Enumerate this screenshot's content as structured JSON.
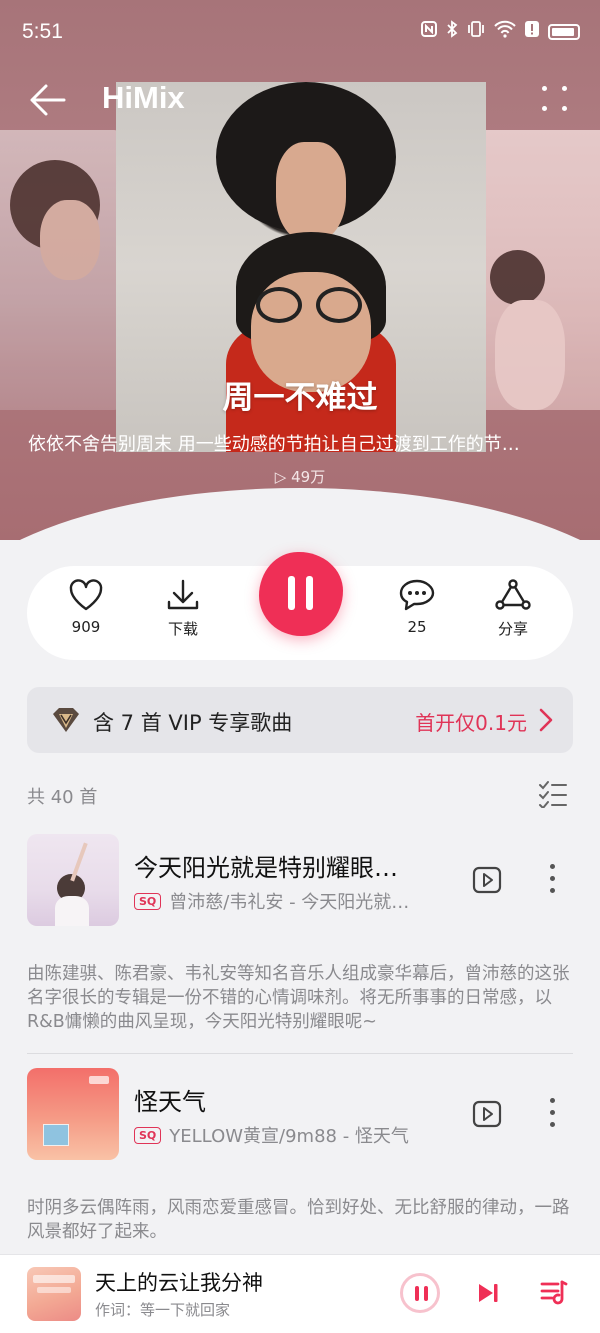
{
  "status_bar": {
    "time": "5:51",
    "icons": [
      "nfc-icon",
      "bluetooth-icon",
      "vibrate-icon",
      "wifi-icon",
      "alert-icon",
      "battery-icon"
    ]
  },
  "header": {
    "app_title": "HiMix",
    "back_icon": "back-arrow-icon",
    "more_icon": "more-dots-icon"
  },
  "playlist": {
    "title": "周一不难过",
    "description": "依依不舍告别周末 用一些动感的节拍让自己过渡到工作的节…",
    "play_count": "▷ 49万"
  },
  "actions": {
    "like_count": "909",
    "download_label": "下载",
    "comment_count": "25",
    "share_label": "分享"
  },
  "vip_banner": {
    "text": "含 7 首 VIP 专享歌曲",
    "price": "首开仅0.1元"
  },
  "list": {
    "count": "共 40 首"
  },
  "songs": [
    {
      "title": "今天阳光就是特别耀眼…",
      "quality": "SQ",
      "artist": "曾沛慈/韦礼安 - 今天阳光就…",
      "description": "由陈建骐、陈君豪、韦礼安等知名音乐人组成豪华幕后，曾沛慈的这张名字很长的专辑是一份不错的心情调味剂。将无所事事的日常感，以R&B慵懒的曲风呈现，今天阳光特别耀眼呢~"
    },
    {
      "title": "怪天气",
      "quality": "SQ",
      "artist": "YELLOW黄宣/9m88 - 怪天气",
      "description": "时阴多云偶阵雨，风雨恋爱重感冒。恰到好处、无比舒服的律动，一路风景都好了起来。"
    }
  ],
  "mini_player": {
    "title": "天上的云让我分神",
    "subtitle": "作词：等一下就回家"
  },
  "colors": {
    "accent": "#ef2f56",
    "hero": "#a77479",
    "background": "#f2f2f4"
  }
}
